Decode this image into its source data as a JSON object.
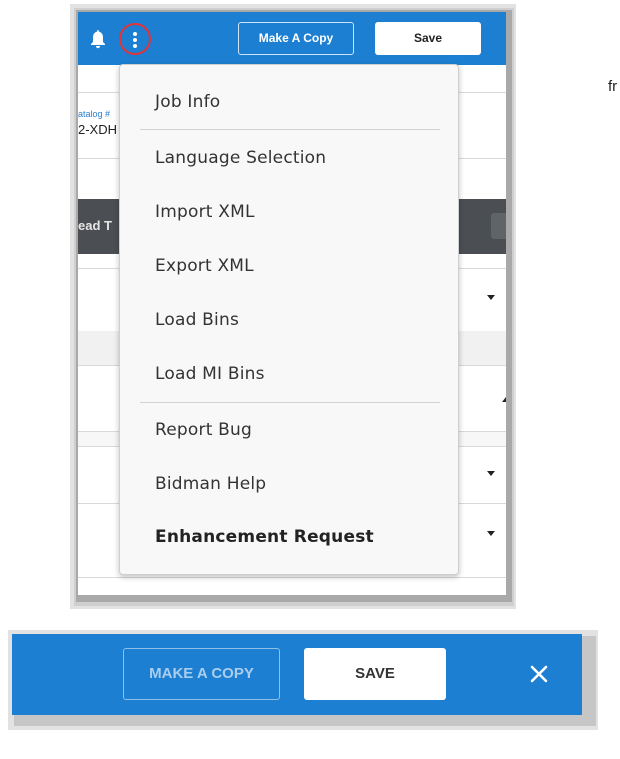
{
  "topbar": {
    "make_copy_label": "Make A Copy",
    "save_label": "Save"
  },
  "background": {
    "catalog_label": "atalog #",
    "catalog_value": "2-XDH",
    "darkbar_text": "ead T"
  },
  "menu": {
    "items": [
      "Job Info",
      "Language Selection",
      "Import XML",
      "Export XML",
      "Load Bins",
      "Load MI Bins",
      "Report Bug",
      "Bidman Help",
      "Enhancement Request"
    ]
  },
  "side_text": "fr",
  "bottombar": {
    "make_copy_label": "MAKE A COPY",
    "save_label": "SAVE"
  },
  "colors": {
    "brand_blue": "#1d7fd1",
    "highlight_red": "#e0343a",
    "dark_header": "#4b4f53"
  },
  "icons": [
    "bell-icon",
    "more-vertical-icon",
    "chevron-down-icon",
    "chevron-up-icon",
    "close-icon"
  ]
}
